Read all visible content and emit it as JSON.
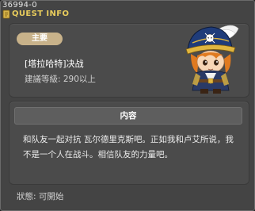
{
  "window": {
    "id": "36994-0",
    "title": "QUEST INFO"
  },
  "quest": {
    "badge": "主要",
    "name": "[塔拉哈特]决战",
    "recommended_level": "建議等級: 290以上"
  },
  "content": {
    "header": "内容",
    "text": "和队友一起对抗 瓦尔德里克斯吧。正如我和卢艾所说，我不是一个人在战斗。相信队友的力量吧。"
  },
  "status": {
    "text": "狀態:  可開始"
  },
  "colors": {
    "title": "#e8cc5c",
    "badge": "#c8b28a",
    "panel": "#4b4b4b",
    "background": "#444444"
  },
  "icons": {
    "title_icon": "scroll-icon",
    "character": "pirate-captain-character"
  }
}
